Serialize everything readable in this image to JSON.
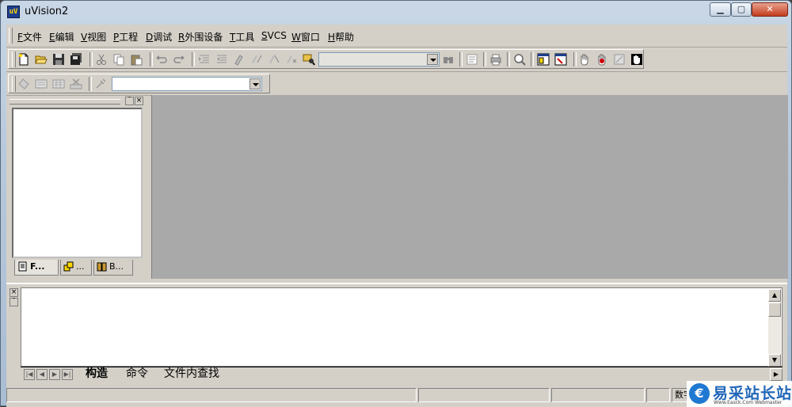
{
  "window": {
    "title": "uVision2",
    "app_icon_text": "uV"
  },
  "menu": [
    {
      "key": "F",
      "label": "文件"
    },
    {
      "key": "E",
      "label": "编辑"
    },
    {
      "key": "V",
      "label": "视图"
    },
    {
      "key": "P",
      "label": "工程"
    },
    {
      "key": "D",
      "label": "调试"
    },
    {
      "key": "R",
      "label": "外围设备"
    },
    {
      "key": "T",
      "label": "工具"
    },
    {
      "key": "S",
      "label": "VCS"
    },
    {
      "key": "W",
      "label": "窗口"
    },
    {
      "key": "H",
      "label": "帮助"
    }
  ],
  "toolbar": {
    "find_value": "",
    "target_value": ""
  },
  "workspace": {
    "tabs": [
      {
        "label": "F...",
        "icon": "files-icon"
      },
      {
        "label": "...",
        "icon": "regs-icon"
      },
      {
        "label": "B...",
        "icon": "books-icon"
      }
    ]
  },
  "output": {
    "tabs": [
      {
        "label": "构造"
      },
      {
        "label": "命令"
      },
      {
        "label": "文件内查找"
      }
    ]
  },
  "status": {
    "num": "数字"
  },
  "watermark": {
    "text": "易采站长站",
    "sub": "Www.Easck.Com Webmaster"
  },
  "colors": {
    "title_gradient": "#b6c8db",
    "close_button": "#c33d1e",
    "editor_bg": "#a9a9a9",
    "face": "#d4d0c8"
  }
}
